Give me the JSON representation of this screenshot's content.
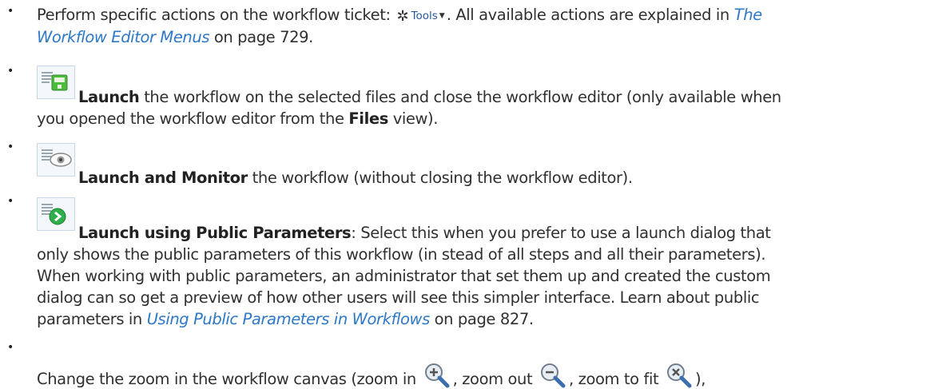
{
  "items": [
    {
      "lines": [
        {
          "before": "Perform specific actions on the workflow ticket: ",
          "tools_label": "Tools",
          "after": ". All available actions are explained in ",
          "link": "The"
        },
        {
          "link": "Workflow Editor Menus",
          "after": " on page 729."
        }
      ]
    },
    {
      "icon": "launch-icon",
      "bold": "Launch",
      "rest": " the workflow on the selected files and close the workflow editor (only available when",
      "line2_before": "you opened the workflow editor from the ",
      "line2_bold": "Files",
      "line2_after": " view)."
    },
    {
      "icon": "launch-monitor-icon",
      "bold": "Launch and Monitor",
      "rest": " the workflow (without closing the workflow editor)."
    },
    {
      "icon": "launch-public-parameters-icon",
      "bold": "Launch using Public Parameters",
      "rest": ": Select this when you prefer to use a launch dialog that",
      "lines": [
        "only shows the public parameters of this workflow (in stead of all steps and all their parameters).",
        "When working with public parameters, an administrator that set them up and created the custom",
        "dialog can so get a preview of how other users will see this simpler interface. Learn about public"
      ],
      "last_before": "parameters in ",
      "last_link": "Using Public Parameters in Workflows",
      "last_after": " on page 827."
    },
    {
      "before": "Change the zoom in the workflow canvas (zoom in ",
      "mid1": ", zoom out ",
      "mid2": ", zoom to fit ",
      "after": "),"
    }
  ],
  "icons": {
    "gear": "gear-icon",
    "caret": "caret-down-icon",
    "zoom_in": "zoom-in-icon",
    "zoom_out": "zoom-out-icon",
    "zoom_fit": "zoom-to-fit-icon"
  },
  "colors": {
    "link": "#2d78c7",
    "text": "#303030",
    "icon_green": "#3db54a",
    "tools_text": "#2a5b9e"
  }
}
